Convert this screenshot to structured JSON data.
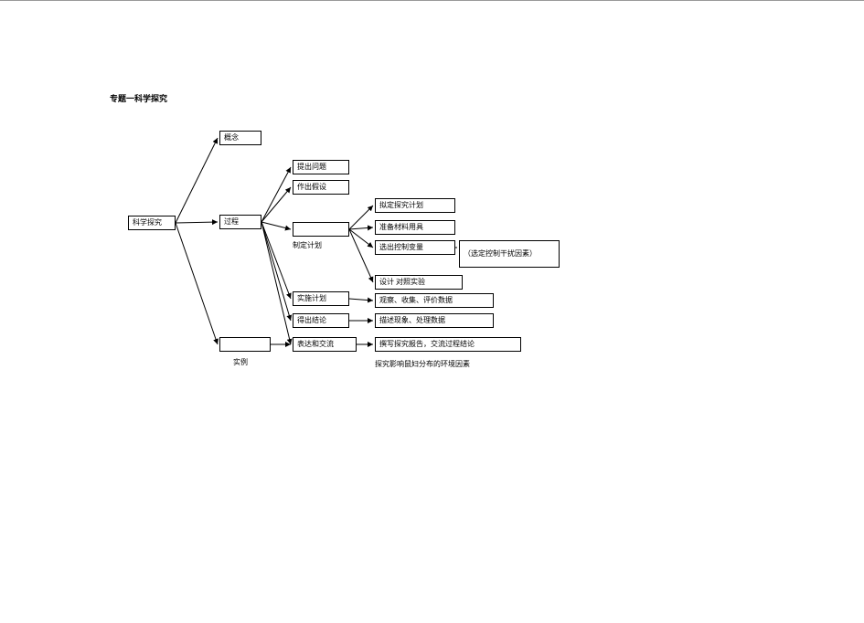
{
  "title": "专题一科学探究",
  "root": "科学探究",
  "branches": {
    "b1": "概念",
    "b2": "过程",
    "b3label": "实例"
  },
  "process": {
    "p1": "提出问题",
    "p2": "作出假设",
    "p3label": "制定计划",
    "p4": "实施计划",
    "p5": "得出结论",
    "p6": "表达和交流"
  },
  "plan": {
    "c1": "拟定探究计划",
    "c2": "准备材料用具",
    "c3a": "选出控制变量",
    "c3b": "（选定控制干扰因素）",
    "c4": "设计 对照实验"
  },
  "impl": "观察、收集、评价数据",
  "concl": "描述现象、处理数据",
  "express": "撰写探究报告，交流过程结论",
  "example": "探究影响鼠妇分布的环境因素"
}
